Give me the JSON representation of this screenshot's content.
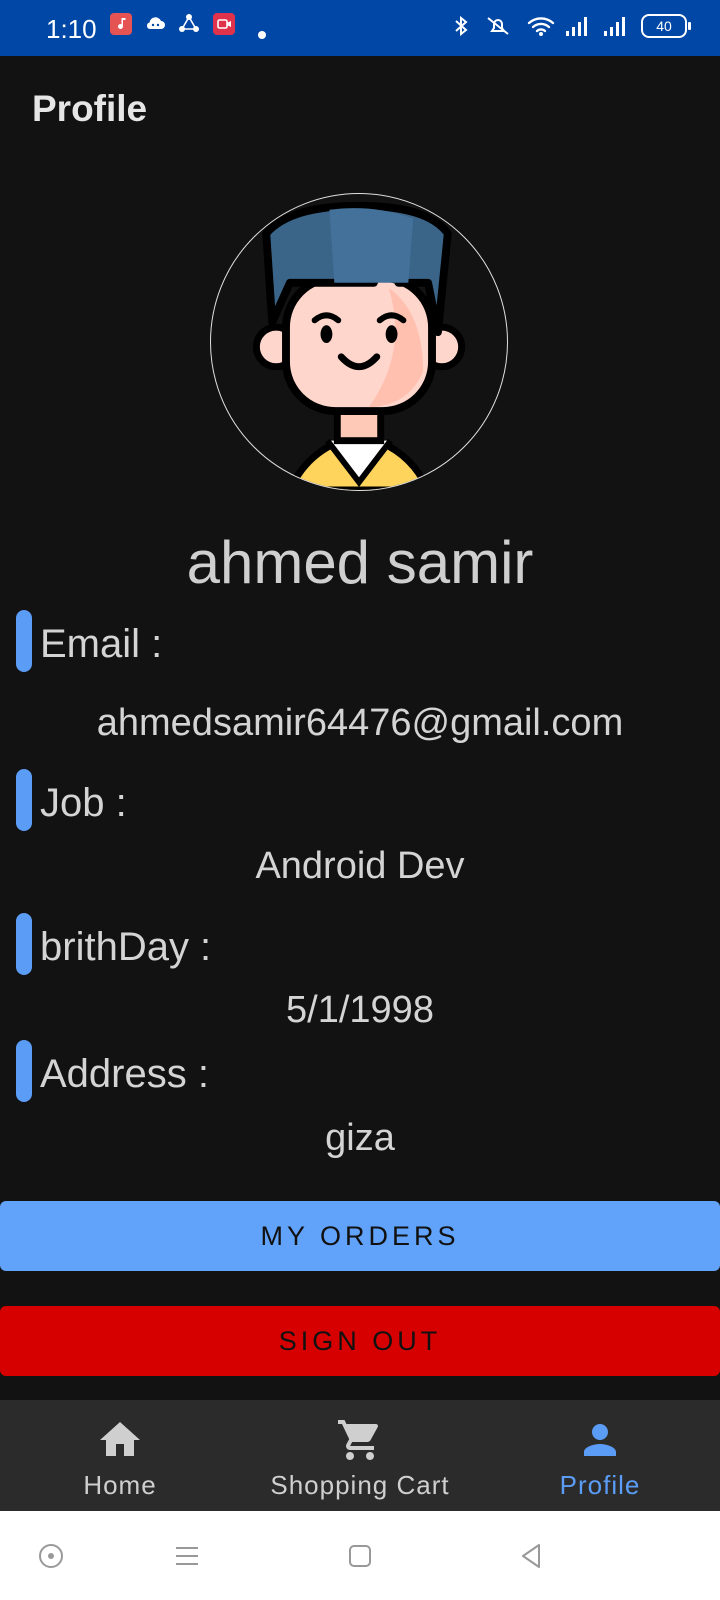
{
  "status_bar": {
    "time": "1:10",
    "battery": "40",
    "app_icons": [
      "music-app-icon",
      "cloud-game-icon",
      "share-icon",
      "video-record-icon"
    ],
    "right_icons": [
      "bluetooth-icon",
      "silent-icon",
      "wifi-icon",
      "signal-icon",
      "signal-icon"
    ]
  },
  "app_bar": {
    "title": "Profile"
  },
  "profile": {
    "name": "ahmed samir",
    "fields": [
      {
        "label": "Email :",
        "value": "ahmedsamir64476@gmail.com"
      },
      {
        "label": "Job :",
        "value": "Android Dev"
      },
      {
        "label": "brithDay :",
        "value": "5/1/1998"
      },
      {
        "label": "Address :",
        "value": "giza"
      }
    ]
  },
  "buttons": {
    "orders": "MY ORDERS",
    "sign_out": "SIGN OUT"
  },
  "bottom_nav": {
    "items": [
      {
        "label": "Home",
        "icon": "home-icon",
        "active": false
      },
      {
        "label": "Shopping Cart",
        "icon": "cart-icon",
        "active": false
      },
      {
        "label": "Profile",
        "icon": "person-icon",
        "active": true
      }
    ]
  },
  "colors": {
    "status_bar": "#0047a6",
    "background": "#121212",
    "accent": "#5b9cf6",
    "orders_button": "#61a3fb",
    "sign_out_button": "#d60000",
    "bottom_nav": "#2b2b2b"
  }
}
